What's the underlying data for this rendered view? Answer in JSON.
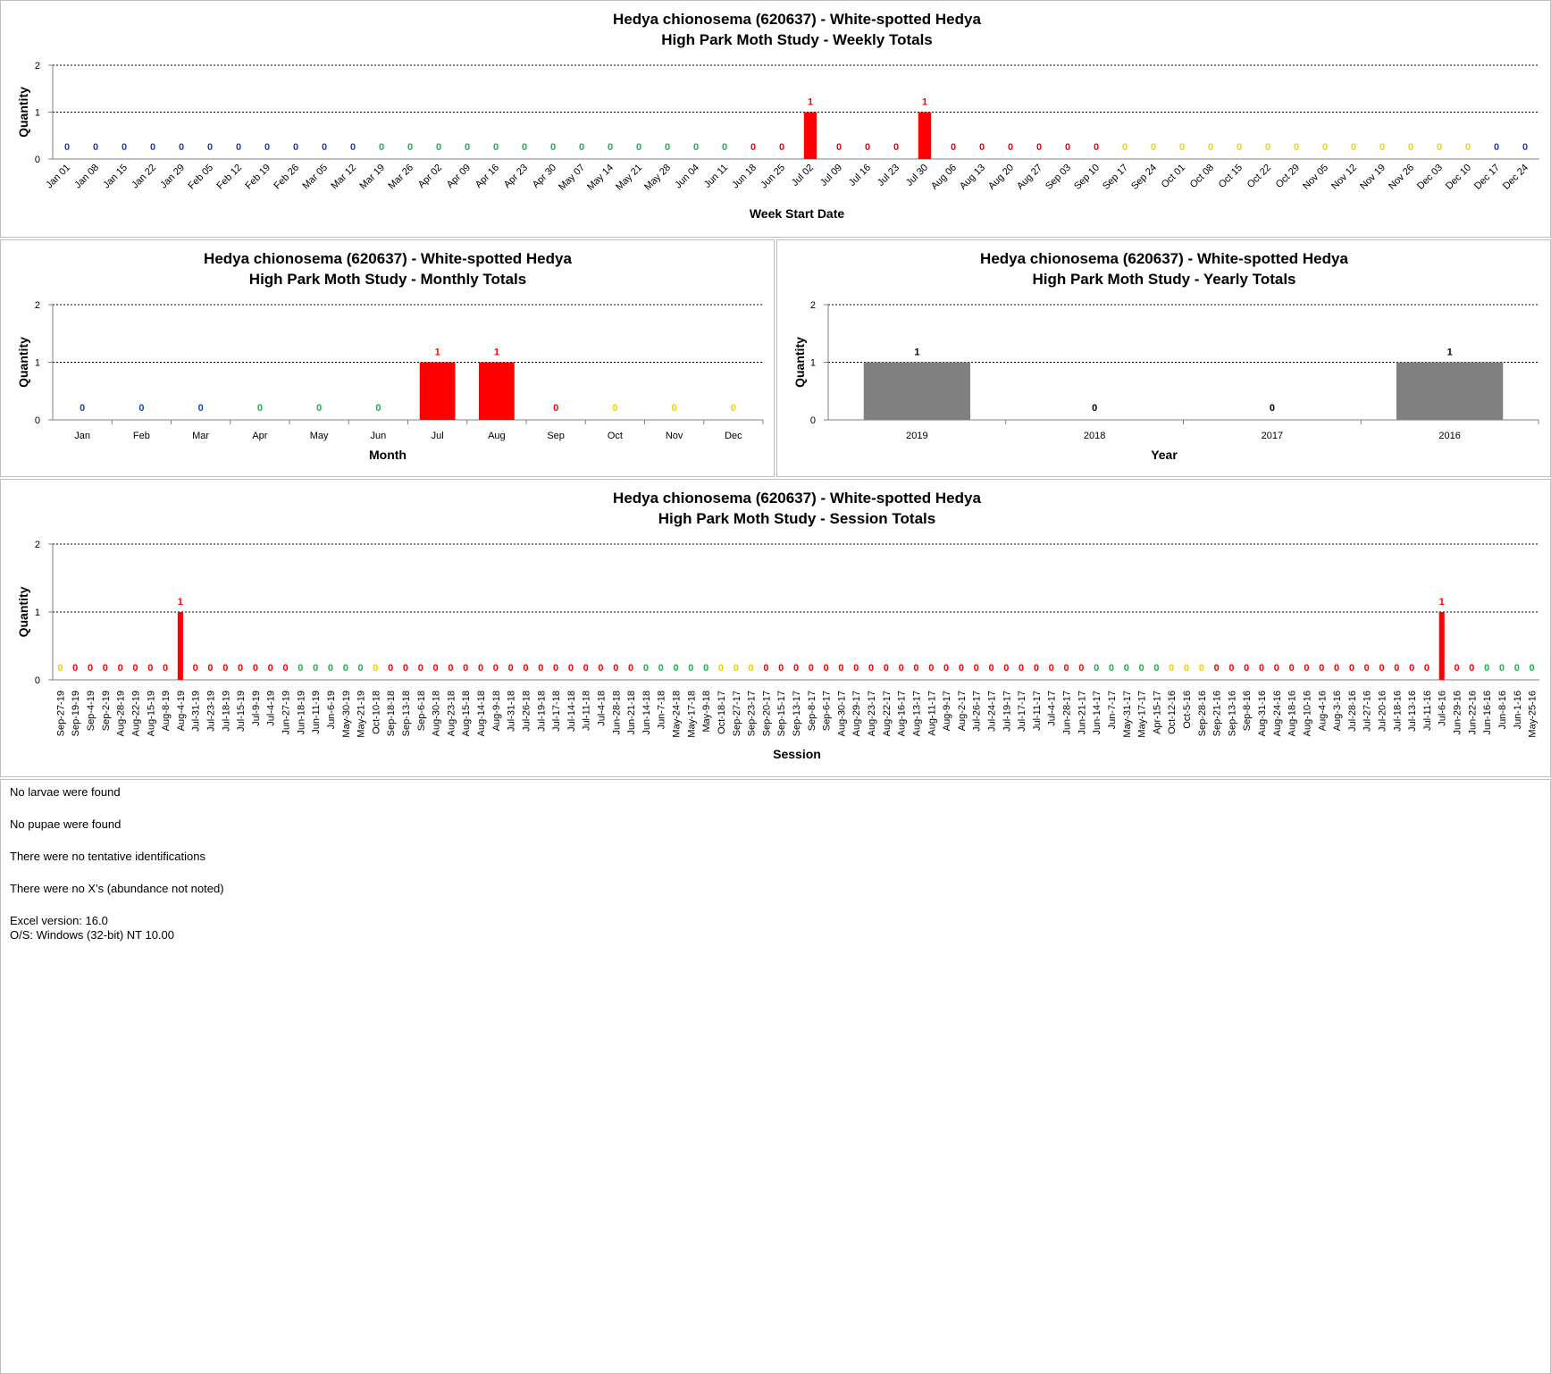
{
  "colors": {
    "blue": "#1f3fbf",
    "green": "#22b04a",
    "red": "#ff0000",
    "yellow": "#f0d000",
    "dark": "#000000",
    "grey": "#808080",
    "bar_red": "#ff0000"
  },
  "weekly": {
    "title1": "Hedya chionosema (620637)  - White-spotted Hedya",
    "title2": "High Park Moth Study  -  Weekly Totals",
    "ylabel": "Quantity",
    "xlabel": "Week Start Date",
    "yticks": [
      "0",
      "1",
      "2"
    ],
    "chart_data": {
      "type": "bar",
      "ylim": [
        0,
        2
      ],
      "categories": [
        "Jan 01",
        "Jan 08",
        "Jan 15",
        "Jan 22",
        "Jan 29",
        "Feb 05",
        "Feb 12",
        "Feb 19",
        "Feb 26",
        "Mar 05",
        "Mar 12",
        "Mar 19",
        "Mar 26",
        "Apr 02",
        "Apr 09",
        "Apr 16",
        "Apr 23",
        "Apr 30",
        "May 07",
        "May 14",
        "May 21",
        "May 28",
        "Jun 04",
        "Jun 11",
        "Jun 18",
        "Jun 25",
        "Jul 02",
        "Jul 09",
        "Jul 16",
        "Jul 23",
        "Jul 30",
        "Aug 06",
        "Aug 13",
        "Aug 20",
        "Aug 27",
        "Sep 03",
        "Sep 10",
        "Sep 17",
        "Sep 24",
        "Oct 01",
        "Oct 08",
        "Oct 15",
        "Oct 22",
        "Oct 29",
        "Nov 05",
        "Nov 12",
        "Nov 19",
        "Nov 26",
        "Dec 03",
        "Dec 10",
        "Dec 17",
        "Dec 24"
      ],
      "values": [
        0,
        0,
        0,
        0,
        0,
        0,
        0,
        0,
        0,
        0,
        0,
        0,
        0,
        0,
        0,
        0,
        0,
        0,
        0,
        0,
        0,
        0,
        0,
        0,
        0,
        0,
        1,
        0,
        0,
        0,
        1,
        0,
        0,
        0,
        0,
        0,
        0,
        0,
        0,
        0,
        0,
        0,
        0,
        0,
        0,
        0,
        0,
        0,
        0,
        0,
        0,
        0
      ],
      "label_colors": [
        "blue",
        "blue",
        "blue",
        "blue",
        "blue",
        "blue",
        "blue",
        "blue",
        "blue",
        "blue",
        "blue",
        "green",
        "green",
        "green",
        "green",
        "green",
        "green",
        "green",
        "green",
        "green",
        "green",
        "green",
        "green",
        "green",
        "red",
        "red",
        "red",
        "red",
        "red",
        "red",
        "red",
        "red",
        "red",
        "red",
        "red",
        "red",
        "red",
        "yellow",
        "yellow",
        "yellow",
        "yellow",
        "yellow",
        "yellow",
        "yellow",
        "yellow",
        "yellow",
        "yellow",
        "yellow",
        "yellow",
        "yellow",
        "blue",
        "blue"
      ]
    }
  },
  "monthly": {
    "title1": "Hedya chionosema (620637)  - White-spotted Hedya",
    "title2": "High Park Moth Study  -  Monthly Totals",
    "ylabel": "Quantity",
    "xlabel": "Month",
    "yticks": [
      "0",
      "1",
      "2"
    ],
    "chart_data": {
      "type": "bar",
      "ylim": [
        0,
        2
      ],
      "categories": [
        "Jan",
        "Feb",
        "Mar",
        "Apr",
        "May",
        "Jun",
        "Jul",
        "Aug",
        "Sep",
        "Oct",
        "Nov",
        "Dec"
      ],
      "values": [
        0,
        0,
        0,
        0,
        0,
        0,
        1,
        1,
        0,
        0,
        0,
        0
      ],
      "label_colors": [
        "blue",
        "blue",
        "blue",
        "green",
        "green",
        "green",
        "red",
        "red",
        "red",
        "yellow",
        "yellow",
        "yellow"
      ]
    }
  },
  "yearly": {
    "title1": "Hedya chionosema (620637)  - White-spotted Hedya",
    "title2": "High Park Moth Study  -  Yearly Totals",
    "ylabel": "Quantity",
    "xlabel": "Year",
    "yticks": [
      "0",
      "1",
      "2"
    ],
    "chart_data": {
      "type": "bar",
      "ylim": [
        0,
        2
      ],
      "categories": [
        "2019",
        "2018",
        "2017",
        "2016"
      ],
      "values": [
        1,
        0,
        0,
        1
      ],
      "label_colors": [
        "dark",
        "dark",
        "dark",
        "dark"
      ]
    }
  },
  "session": {
    "title1": "Hedya chionosema (620637)  - White-spotted Hedya",
    "title2": "High Park Moth Study  -  Session Totals",
    "ylabel": "Quantity",
    "xlabel": "Session",
    "yticks": [
      "0",
      "1",
      "2"
    ],
    "chart_data": {
      "type": "bar",
      "ylim": [
        0,
        2
      ],
      "categories": [
        "Sep-27-19",
        "Sep-19-19",
        "Sep-4-19",
        "Sep-2-19",
        "Aug-28-19",
        "Aug-22-19",
        "Aug-15-19",
        "Aug-8-19",
        "Aug-4-19",
        "Jul-31-19",
        "Jul-23-19",
        "Jul-18-19",
        "Jul-15-19",
        "Jul-9-19",
        "Jul-4-19",
        "Jun-27-19",
        "Jun-18-19",
        "Jun-11-19",
        "Jun-6-19",
        "May-30-19",
        "May-21-19",
        "Oct-10-18",
        "Sep-18-18",
        "Sep-13-18",
        "Sep-6-18",
        "Aug-30-18",
        "Aug-23-18",
        "Aug-15-18",
        "Aug-14-18",
        "Aug-9-18",
        "Jul-31-18",
        "Jul-26-18",
        "Jul-19-18",
        "Jul-17-18",
        "Jul-14-18",
        "Jul-11-18",
        "Jul-4-18",
        "Jun-28-18",
        "Jun-21-18",
        "Jun-14-18",
        "Jun-7-18",
        "May-24-18",
        "May-17-18",
        "May-9-18",
        "Oct-18-17",
        "Sep-27-17",
        "Sep-23-17",
        "Sep-20-17",
        "Sep-15-17",
        "Sep-13-17",
        "Sep-8-17",
        "Sep-6-17",
        "Aug-30-17",
        "Aug-29-17",
        "Aug-23-17",
        "Aug-22-17",
        "Aug-16-17",
        "Aug-13-17",
        "Aug-11-17",
        "Aug-9-17",
        "Aug-2-17",
        "Jul-26-17",
        "Jul-24-17",
        "Jul-19-17",
        "Jul-17-17",
        "Jul-11-17",
        "Jul-4-17",
        "Jun-28-17",
        "Jun-21-17",
        "Jun-14-17",
        "Jun-7-17",
        "May-31-17",
        "May-17-17",
        "Apr-15-17",
        "Oct-12-16",
        "Oct-5-16",
        "Sep-28-16",
        "Sep-21-16",
        "Sep-13-16",
        "Sep-8-16",
        "Aug-31-16",
        "Aug-24-16",
        "Aug-18-16",
        "Aug-10-16",
        "Aug-4-16",
        "Aug-3-16",
        "Jul-28-16",
        "Jul-27-16",
        "Jul-20-16",
        "Jul-18-16",
        "Jul-13-16",
        "Jul-11-16",
        "Jul-6-16",
        "Jun-29-16",
        "Jun-22-16",
        "Jun-16-16",
        "Jun-8-16",
        "Jun-1-16",
        "May-25-16"
      ],
      "values": [
        0,
        0,
        0,
        0,
        0,
        0,
        0,
        0,
        1,
        0,
        0,
        0,
        0,
        0,
        0,
        0,
        0,
        0,
        0,
        0,
        0,
        0,
        0,
        0,
        0,
        0,
        0,
        0,
        0,
        0,
        0,
        0,
        0,
        0,
        0,
        0,
        0,
        0,
        0,
        0,
        0,
        0,
        0,
        0,
        0,
        0,
        0,
        0,
        0,
        0,
        0,
        0,
        0,
        0,
        0,
        0,
        0,
        0,
        0,
        0,
        0,
        0,
        0,
        0,
        0,
        0,
        0,
        0,
        0,
        0,
        0,
        0,
        0,
        0,
        0,
        0,
        0,
        0,
        0,
        0,
        0,
        0,
        0,
        0,
        0,
        0,
        0,
        0,
        0,
        0,
        0,
        0,
        1,
        0,
        0,
        0,
        0,
        0,
        0
      ],
      "label_colors": [
        "yellow",
        "red",
        "red",
        "red",
        "red",
        "red",
        "red",
        "red",
        "red",
        "red",
        "red",
        "red",
        "red",
        "red",
        "red",
        "red",
        "green",
        "green",
        "green",
        "green",
        "green",
        "yellow",
        "red",
        "red",
        "red",
        "red",
        "red",
        "red",
        "red",
        "red",
        "red",
        "red",
        "red",
        "red",
        "red",
        "red",
        "red",
        "red",
        "red",
        "green",
        "green",
        "green",
        "green",
        "green",
        "yellow",
        "yellow",
        "yellow",
        "red",
        "red",
        "red",
        "red",
        "red",
        "red",
        "red",
        "red",
        "red",
        "red",
        "red",
        "red",
        "red",
        "red",
        "red",
        "red",
        "red",
        "red",
        "red",
        "red",
        "red",
        "red",
        "green",
        "green",
        "green",
        "green",
        "green",
        "yellow",
        "yellow",
        "yellow",
        "red",
        "red",
        "red",
        "red",
        "red",
        "red",
        "red",
        "red",
        "red",
        "red",
        "red",
        "red",
        "red",
        "red",
        "red",
        "red",
        "red",
        "red",
        "green",
        "green",
        "green",
        "green"
      ]
    }
  },
  "notes": {
    "larvae": "No larvae were found",
    "pupae": "No pupae were found",
    "tentative": "There were no tentative identifications",
    "xs": "There were no X's (abundance not noted)",
    "excel": "Excel version: 16.0",
    "os": "O/S: Windows (32-bit) NT 10.00"
  }
}
